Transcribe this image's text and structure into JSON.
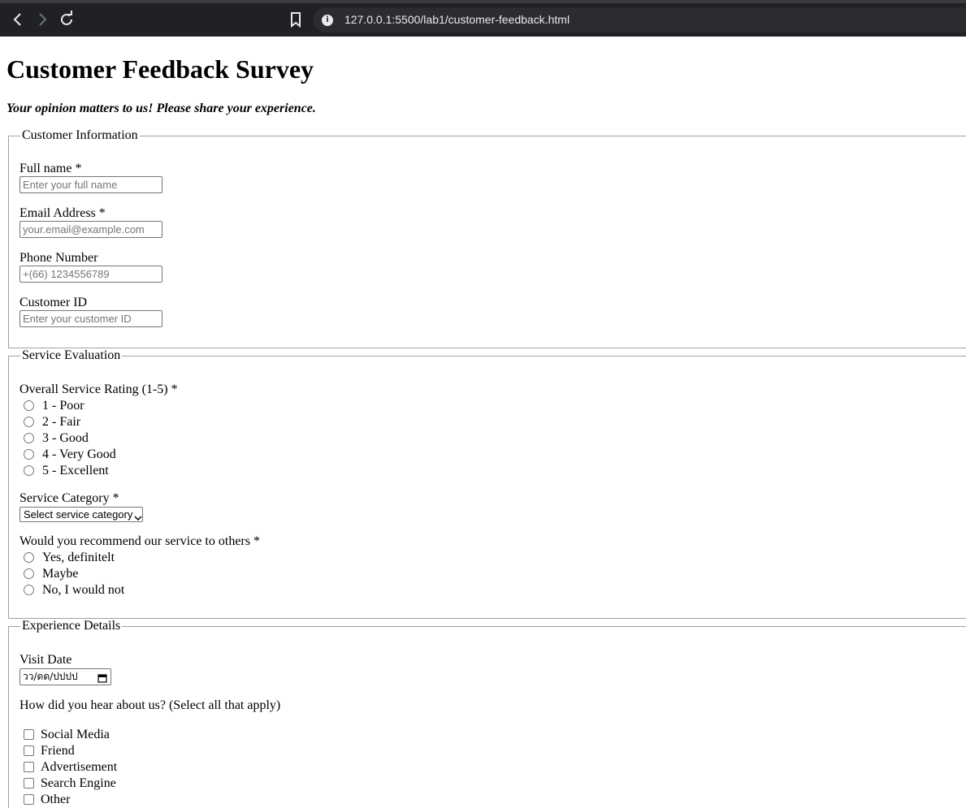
{
  "browser": {
    "url": "127.0.0.1:5500/lab1/customer-feedback.html",
    "back_icon": "back-arrow-icon",
    "forward_icon": "forward-arrow-icon",
    "reload_icon": "reload-icon",
    "bookmark_icon": "bookmark-icon",
    "info_icon": "site-info-icon"
  },
  "page": {
    "title": "Customer Feedback Survey",
    "subtitle": "Your opinion matters to us! Please share your experience."
  },
  "customer_info": {
    "legend": "Customer Information",
    "full_name": {
      "label": "Full name *",
      "placeholder": "Enter your full name"
    },
    "email": {
      "label": "Email Address *",
      "placeholder": "your.email@example.com"
    },
    "phone": {
      "label": "Phone Number",
      "placeholder": "+(66) 1234556789"
    },
    "customer_id": {
      "label": "Customer ID",
      "placeholder": "Enter your customer ID"
    }
  },
  "service_eval": {
    "legend": "Service Evaluation",
    "rating_label": "Overall Service Rating (1-5) *",
    "rating_options": [
      "1 - Poor",
      "2 - Fair",
      "3 - Good",
      "4 - Very Good",
      "5 - Excellent"
    ],
    "category_label": "Service Category *",
    "category_selected": "Select service category",
    "recommend_label": "Would you recommend our service to others *",
    "recommend_options": [
      "Yes, definitelt",
      "Maybe",
      "No, I would not"
    ]
  },
  "experience": {
    "legend": "Experience Details",
    "visit_date_label": "Visit Date",
    "visit_date_value": "วว/ดด/ปปปป",
    "hear_label": "How did you hear about us? (Select all that apply)",
    "hear_options": [
      "Social Media",
      "Friend",
      "Advertisement",
      "Search Engine",
      "Other"
    ]
  }
}
